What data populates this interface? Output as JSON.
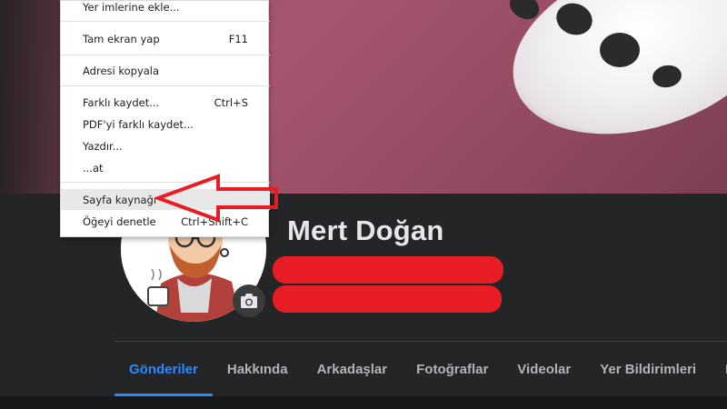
{
  "context_menu": {
    "items": [
      {
        "label": "Yer imlerine ekle...",
        "shortcut": ""
      },
      {
        "label": "Tam ekran yap",
        "shortcut": "F11"
      },
      {
        "label": "Adresi kopyala",
        "shortcut": ""
      },
      {
        "label": "Farklı kaydet...",
        "shortcut": "Ctrl+S"
      },
      {
        "label": "PDF'yi farklı kaydet...",
        "shortcut": ""
      },
      {
        "label": "Yazdır...",
        "shortcut": ""
      },
      {
        "label": "...at",
        "shortcut": ""
      },
      {
        "label": "Sayfa kaynağı",
        "shortcut": ""
      },
      {
        "label": "Öğeyi denetle",
        "shortcut": "Ctrl+Shift+C"
      }
    ],
    "highlighted_item": "Sayfa kaynağı"
  },
  "profile": {
    "name": "Mert Doğan",
    "avatar_icon": "cartoon-avatar-icon",
    "camera_icon": "camera-icon"
  },
  "tabs": [
    {
      "label": "Gönderiler",
      "active": true
    },
    {
      "label": "Hakkında",
      "active": false
    },
    {
      "label": "Arkadaşlar",
      "active": false
    },
    {
      "label": "Fotoğraflar",
      "active": false
    },
    {
      "label": "Videolar",
      "active": false
    },
    {
      "label": "Yer Bildirimleri",
      "active": false
    },
    {
      "label": "Diğe",
      "active": false
    }
  ],
  "colors": {
    "accent": "#2d88ff",
    "annotation_red": "#e81c24",
    "header_bg": "#242526"
  }
}
